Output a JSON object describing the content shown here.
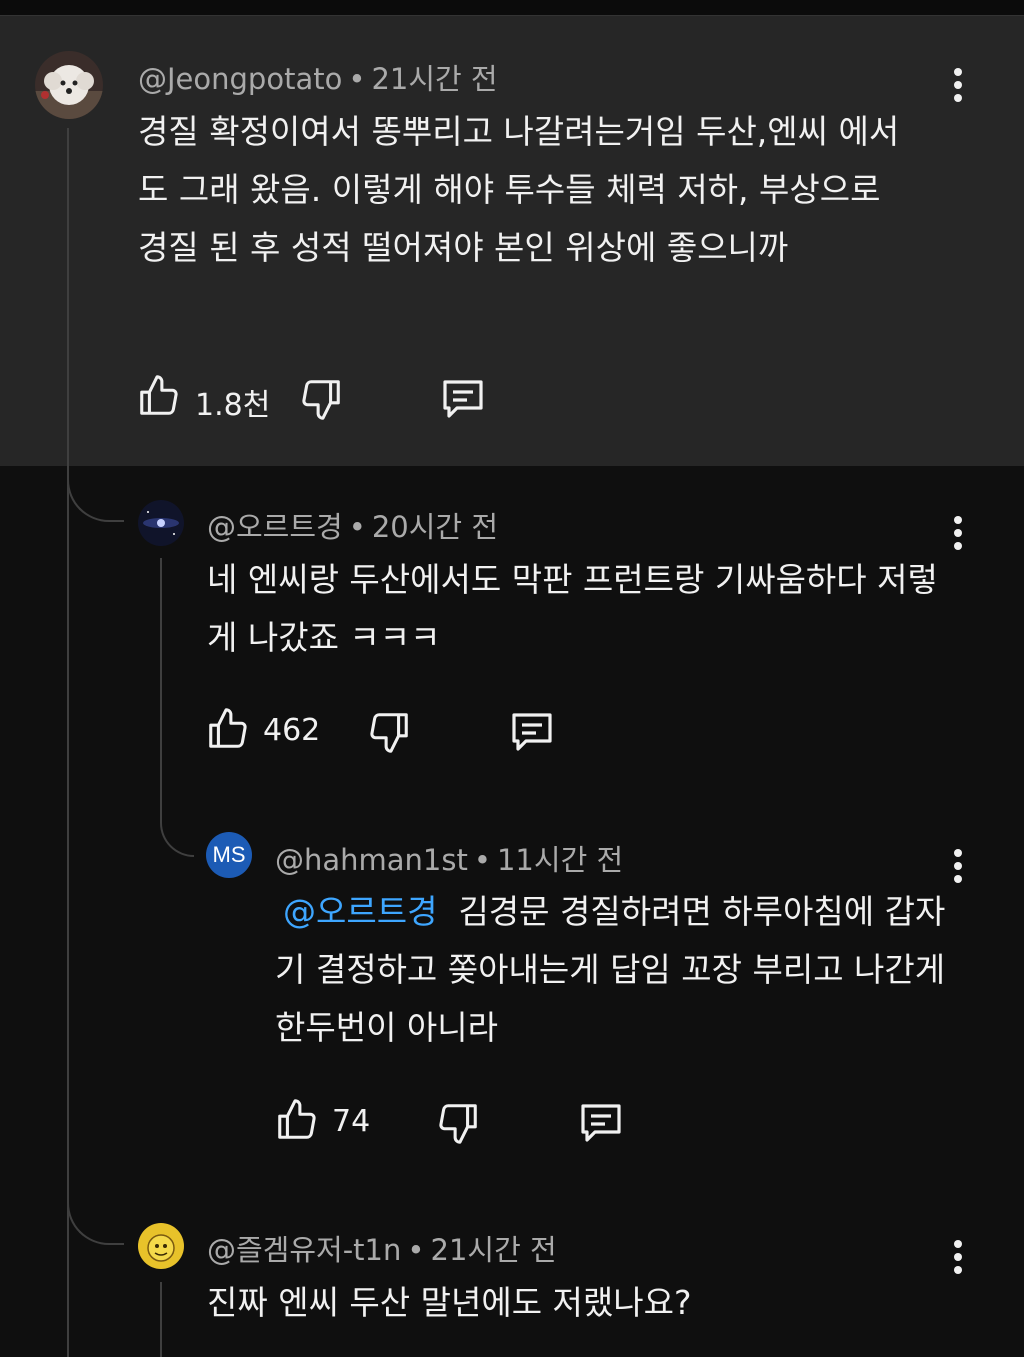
{
  "comments": [
    {
      "handle": "@Jeongpotato",
      "time": "21시간 전",
      "text": "경질 확정이여서 똥뿌리고 나갈려는거임 두산,엔씨 에서도 그래 왔음. 이렇게 해야 투수들 체력 저하, 부상으로 경질 된 후 성적 떨어져야 본인 위상에 좋으니까",
      "likes": "1.8천",
      "avatar_icon": "dog-photo-avatar"
    },
    {
      "handle": "@오르트경",
      "time": "20시간 전",
      "text": "네 엔씨랑 두산에서도 막판 프런트랑 기싸움하다 저렇게 나갔죠 ㅋㅋㅋ",
      "likes": "462",
      "avatar_icon": "galaxy-avatar"
    },
    {
      "handle": "@hahman1st",
      "time": "11시간 전",
      "mention": "@오르트경",
      "text": "김경문 경질하려면 하루아침에 갑자기 결정하고 쫒아내는게 답임 꼬장 부리고 나간게 한두번이 아니라",
      "likes": "74",
      "avatar_initials": "MS"
    },
    {
      "handle": "@즐겜유저-t1n",
      "time": "21시간 전",
      "text": "진짜 엔씨 두산 말년에도 저랬나요?",
      "avatar_icon": "yellow-character-avatar"
    }
  ],
  "colors": {
    "background": "#0f0f0f",
    "highlight": "#262626",
    "text": "#f1f1f1",
    "meta": "#aaaaaa",
    "mention": "#3ea6ff"
  },
  "icons": [
    "like-icon",
    "dislike-icon",
    "reply-icon",
    "more-vert-icon"
  ]
}
